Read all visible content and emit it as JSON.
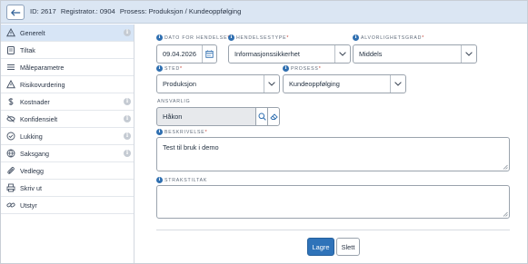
{
  "header": {
    "id_text": "ID: 2617",
    "registrator_text": "Registrator.: 0904",
    "prosess_text": "Prosess: Produksjon / Kundeoppfølging"
  },
  "sidebar": {
    "items": [
      {
        "label": "Generelt",
        "icon": "warning-triangle-icon",
        "active": true,
        "info": true
      },
      {
        "label": "Tiltak",
        "icon": "clipboard-icon",
        "info": false
      },
      {
        "label": "Måleparametre",
        "icon": "list-icon",
        "info": false
      },
      {
        "label": "Risikovurdering",
        "icon": "warning-icon",
        "info": false
      },
      {
        "label": "Kostnader",
        "icon": "dollar-icon",
        "info": true
      },
      {
        "label": "Konfidensielt",
        "icon": "eye-off-icon",
        "info": true
      },
      {
        "label": "Lukking",
        "icon": "check-circle-icon",
        "info": true
      },
      {
        "label": "Saksgang",
        "icon": "globe-icon",
        "info": true
      },
      {
        "label": "Vedlegg",
        "icon": "paperclip-icon",
        "info": false
      },
      {
        "label": "Skriv ut",
        "icon": "printer-icon",
        "info": false
      },
      {
        "label": "Utstyr",
        "icon": "link-icon",
        "info": false
      }
    ],
    "info_glyph": "i"
  },
  "form": {
    "info_glyph": "i",
    "required_mark": "*",
    "dato": {
      "label": "DATO FOR HENDELSE",
      "value": "09.04.2026"
    },
    "hendelsestype": {
      "label": "HENDELSESTYPE",
      "value": "Informasjonssikkerhet"
    },
    "alvorlighetsgrad": {
      "label": "ALVORLIGHETSGRAD",
      "value": "Middels"
    },
    "sted": {
      "label": "STED",
      "value": "Produksjon"
    },
    "prosess": {
      "label": "PROSESS",
      "value": "Kundeoppfølging"
    },
    "ansvarlig": {
      "label": "ANSVARLIG",
      "value": "Håkon"
    },
    "beskrivelse": {
      "label": "BESKRIVELSE",
      "value": "Test til bruk i demo"
    },
    "strakstiltak": {
      "label": "STRAKSTILTAK",
      "value": ""
    }
  },
  "buttons": {
    "save": "Lagre",
    "delete": "Slett"
  },
  "colors": {
    "accent": "#2f73b9",
    "header_bg": "#dbe6f3",
    "active_item_bg": "#d7e5f6",
    "required": "#c0392b"
  }
}
